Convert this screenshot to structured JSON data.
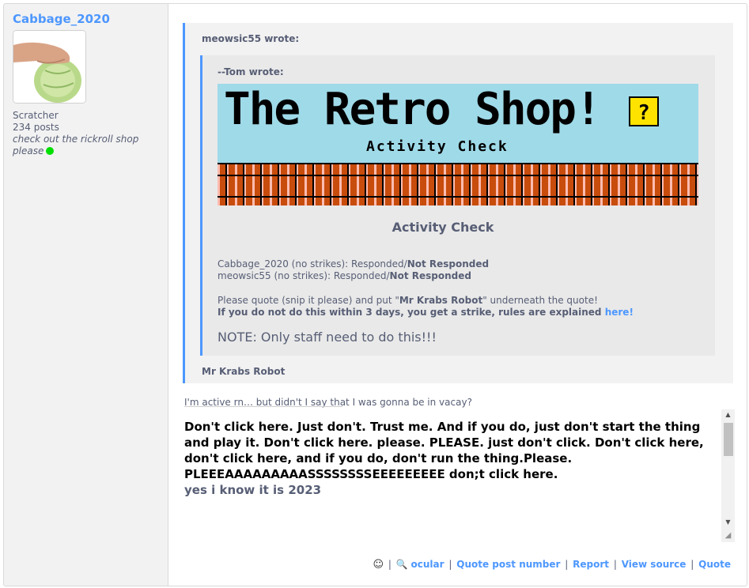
{
  "user": {
    "name": "Cabbage_2020",
    "rank": "Scratcher",
    "posts": "234 posts",
    "status": "check out the rickroll shop please"
  },
  "quote_outer": {
    "author": "meowsic55 wrote:",
    "signature": "Mr Krabs Robot"
  },
  "quote_inner": {
    "author": "--Tom wrote:",
    "banner_title": "The Retro Shop!",
    "banner_subtitle": "Activity Check",
    "banner_icon": "?",
    "heading": "Activity Check",
    "line1_prefix": "Cabbage_2020 (no strikes): Responded/",
    "line1_bold": "Not Responded",
    "line2_prefix": "meowsic55 (no strikes): Responded/",
    "line2_bold": "Not Responded",
    "line3_prefix": "Please quote (snip it please) and put \"",
    "line3_bold": "Mr Krabs Robot",
    "line3_suffix": "\" underneath the quote!",
    "line4": "If you do not do this within 3 days, you get a strike, rules are explained ",
    "line4_link": "here!",
    "note": "NOTE: Only staff need to do this!!!"
  },
  "reply": {
    "text": "I'm active rn… but didn't I say that I was gonna be in vacay?"
  },
  "signature": {
    "text": "Don't click here. Just don't. Trust me. And if you do, just don't start the thing and play it. Don't click here. please. PLEASE. just don't click. Don't click here, don't click here, and if you do, don't run the thing.Please. PLEEEAAAAAAAAASSSSSSSSEEEEEEEEE don;t click here.",
    "last_line": "yes i know it is 2023"
  },
  "actions": {
    "ocular": "ocular",
    "quote_number": "Quote post number",
    "report": "Report",
    "view_source": "View source",
    "quote": "Quote",
    "separator": "|"
  },
  "colors": {
    "link": "#4d97ff",
    "text": "#575e75",
    "quote_bg": "#f2f2f2",
    "online": "#00e000"
  }
}
